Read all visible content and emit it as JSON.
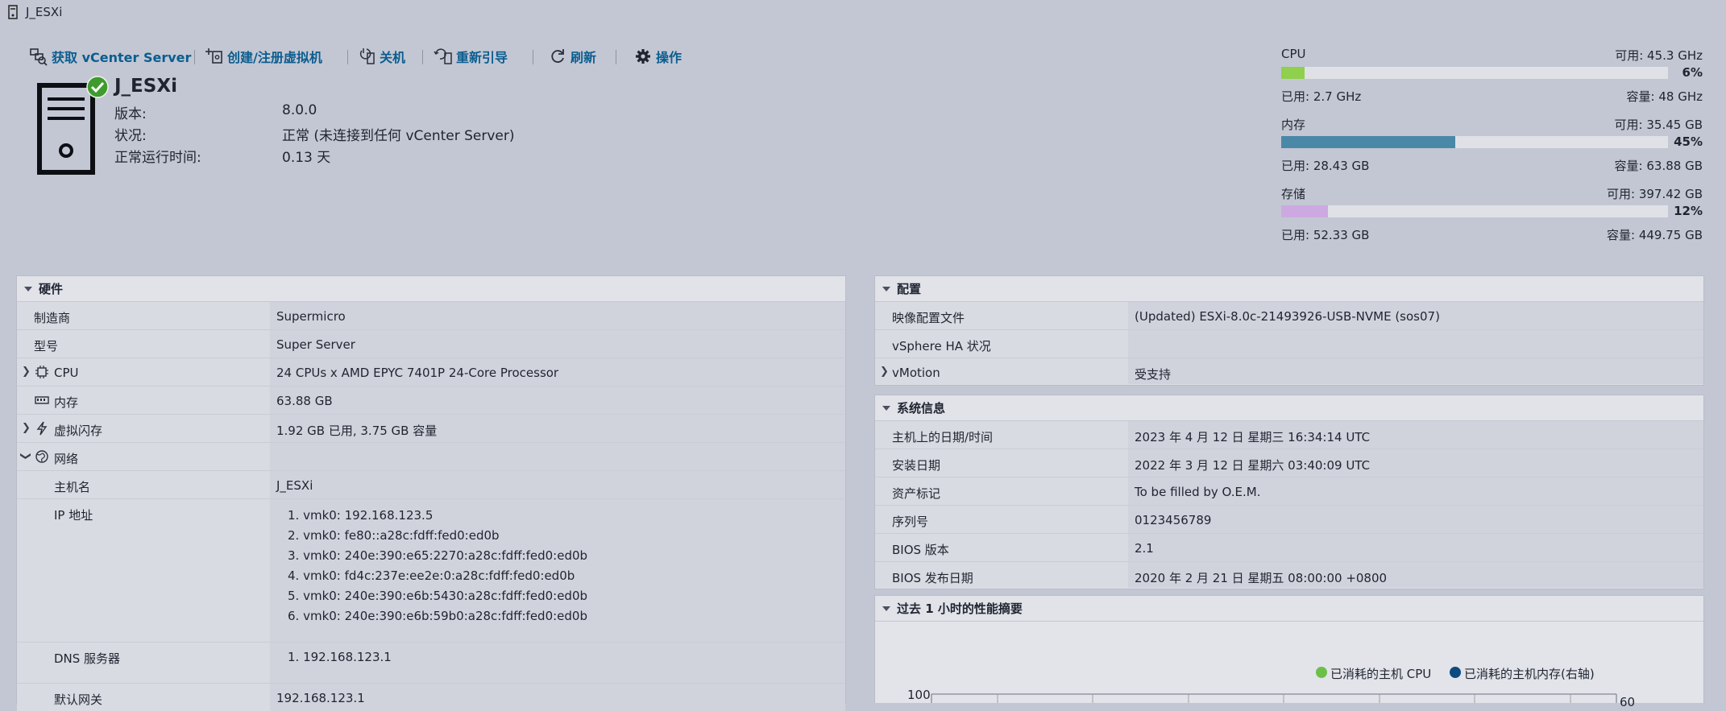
{
  "window": {
    "title": "J_ESXi"
  },
  "toolbar": {
    "items": [
      {
        "label": "获取 vCenter Server",
        "icon": "vcenter-icon"
      },
      {
        "label": "创建/注册虚拟机",
        "icon": "create-vm-icon"
      },
      {
        "label": "关机",
        "icon": "power-off-icon"
      },
      {
        "label": "重新引导",
        "icon": "reboot-icon"
      },
      {
        "label": "刷新",
        "icon": "refresh-icon"
      },
      {
        "label": "操作",
        "icon": "gear-icon"
      }
    ]
  },
  "host": {
    "name": "J_ESXi",
    "fields": [
      {
        "label": "版本:",
        "value": "8.0.0"
      },
      {
        "label": "状况:",
        "value": "正常 (未连接到任何 vCenter Server)"
      },
      {
        "label": "正常运行时间:",
        "value": "0.13 天"
      }
    ]
  },
  "resources": [
    {
      "label": "CPU",
      "free": "可用: 45.3 GHz",
      "percent_text": "6%",
      "percent": 6,
      "used": "已用: 2.7 GHz",
      "capacity": "容量: 48 GHz",
      "color": "#8fd04d"
    },
    {
      "label": "内存",
      "free": "可用: 35.45 GB",
      "percent_text": "45%",
      "percent": 45,
      "used": "已用: 28.43 GB",
      "capacity": "容量: 63.88 GB",
      "color": "#4a88a8"
    },
    {
      "label": "存储",
      "free": "可用: 397.42 GB",
      "percent_text": "12%",
      "percent": 12,
      "used": "已用: 52.33 GB",
      "capacity": "容量: 449.75 GB",
      "color": "#cda9e2"
    }
  ],
  "hardware": {
    "title": "硬件",
    "manufacturer": {
      "label": "制造商",
      "value": "Supermicro"
    },
    "model": {
      "label": "型号",
      "value": "Super Server"
    },
    "cpu": {
      "label": "CPU",
      "value": "24 CPUs x AMD EPYC 7401P 24-Core Processor"
    },
    "memory": {
      "label": "内存",
      "value": "63.88 GB"
    },
    "vflash": {
      "label": "虚拟闪存",
      "value": "1.92 GB 已用, 3.75 GB 容量"
    },
    "network": {
      "label": "网络"
    },
    "hostname": {
      "label": "主机名",
      "value": "J_ESXi"
    },
    "ip": {
      "label": "IP 地址",
      "values": [
        "1. vmk0: 192.168.123.5",
        "2. vmk0: fe80::a28c:fdff:fed0:ed0b",
        "3. vmk0: 240e:390:e65:2270:a28c:fdff:fed0:ed0b",
        "4. vmk0: fd4c:237e:ee2e:0:a28c:fdff:fed0:ed0b",
        "5. vmk0: 240e:390:e6b:5430:a28c:fdff:fed0:ed0b",
        "6. vmk0: 240e:390:e6b:59b0:a28c:fdff:fed0:ed0b"
      ]
    },
    "dns": {
      "label": "DNS 服务器",
      "values": [
        "1. 192.168.123.1"
      ]
    },
    "gateway": {
      "label": "默认网关",
      "value": "192.168.123.1"
    }
  },
  "configuration": {
    "title": "配置",
    "rows": [
      {
        "label": "映像配置文件",
        "value": "(Updated) ESXi-8.0c-21493926-USB-NVME (sos07)"
      },
      {
        "label": "vSphere HA 状况",
        "value": ""
      },
      {
        "label": "vMotion",
        "value": "受支持"
      }
    ]
  },
  "system_info": {
    "title": "系统信息",
    "rows": [
      {
        "label": "主机上的日期/时间",
        "value": "2023 年 4 月 12 日 星期三 16:34:14 UTC"
      },
      {
        "label": "安装日期",
        "value": "2022 年 3 月 12 日 星期六 03:40:09 UTC"
      },
      {
        "label": "资产标记",
        "value": "To be filled by O.E.M."
      },
      {
        "label": "序列号",
        "value": "0123456789"
      },
      {
        "label": "BIOS 版本",
        "value": "2.1"
      },
      {
        "label": "BIOS 发布日期",
        "value": "2020 年 2 月 21 日 星期五 08:00:00 +0800"
      }
    ]
  },
  "perf": {
    "title": "过去 1 小时的性能摘要",
    "colors": {
      "cpu": "#6cc04a",
      "memory": "#0f4a7f"
    }
  },
  "chart_data": {
    "type": "line",
    "title": "",
    "series": [
      {
        "name": "已消耗的主机 CPU",
        "values": []
      },
      {
        "name": "已消耗的主机内存(右轴)",
        "values": []
      }
    ],
    "y_left_ticks": [
      "100"
    ],
    "y_right_ticks": [
      "60"
    ],
    "grid": true,
    "legend": "top"
  }
}
